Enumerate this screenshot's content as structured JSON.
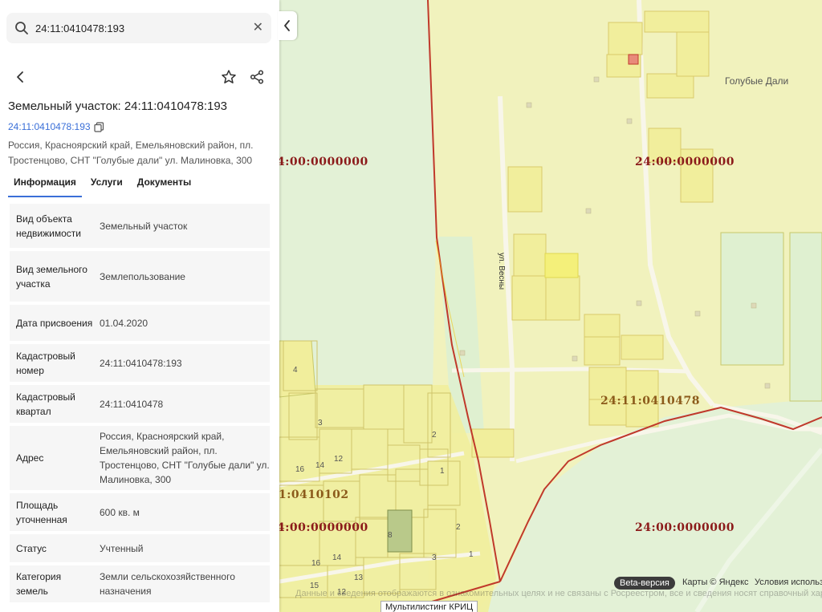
{
  "search": {
    "value": "24:11:0410478:193"
  },
  "object": {
    "title": "Земельный участок: 24:11:0410478:193",
    "cadastral_link": "24:11:0410478:193",
    "address_line": "Россия, Красноярский край, Емельяновский район, пл. Тростенцово, СНТ \"Голубые дали\" ул. Малиновка, 300"
  },
  "tabs": [
    {
      "label": "Информация"
    },
    {
      "label": "Услуги"
    },
    {
      "label": "Документы"
    }
  ],
  "properties": [
    {
      "label": "Вид объекта недвижимости",
      "value": "Земельный участок"
    },
    {
      "label": "Вид земельного участка",
      "value": "Землепользование"
    },
    {
      "label": "Дата присвоения",
      "value": "01.04.2020"
    },
    {
      "label": "Кадастровый номер",
      "value": "24:11:0410478:193"
    },
    {
      "label": "Кадастровый квартал",
      "value": "24:11:0410478"
    },
    {
      "label": "Адрес",
      "value": "Россия, Красноярский край, Емельяновский район, пл. Тростенцово, СНТ \"Голубые дали\" ул. Малиновка, 300"
    },
    {
      "label": "Площадь уточненная",
      "value": "600 кв. м"
    },
    {
      "label": "Статус",
      "value": "Учтенный"
    },
    {
      "label": "Категория земель",
      "value": "Земли сельскохозяйственного назначения"
    }
  ],
  "map": {
    "labels": {
      "zone_top_left": "4:00:0000000",
      "zone_top_right": "24:00:0000000",
      "zone_bottom_left": "4:00:0000000",
      "zone_bottom_right": "24:00:0000000",
      "quarter_main": "24:11:0410478",
      "quarter_left": "1:0410102"
    },
    "place_name": "Голубые Дали",
    "street_name": "ул. Весны",
    "beta": "Beta-версия",
    "copyright": "Карты © Яндекс",
    "terms": "Условия использ",
    "krits": "Мультилистинг КРИЦ",
    "disclaimer": "Данные и сведения отображаются в ознакомительных целях и не связаны с Росреестром, все и сведения носят справочный характер",
    "plot_numbers": [
      "4",
      "3",
      "2",
      "16",
      "14",
      "12",
      "1",
      "8",
      "14",
      "16",
      "15",
      "13",
      "12",
      "1",
      "3",
      "2"
    ]
  },
  "colors": {
    "accent": "#3a6fd8",
    "map_bg": "#e3f1d6",
    "parcel_fill": "#f1ee9c",
    "boundary_red": "#c0392b"
  }
}
